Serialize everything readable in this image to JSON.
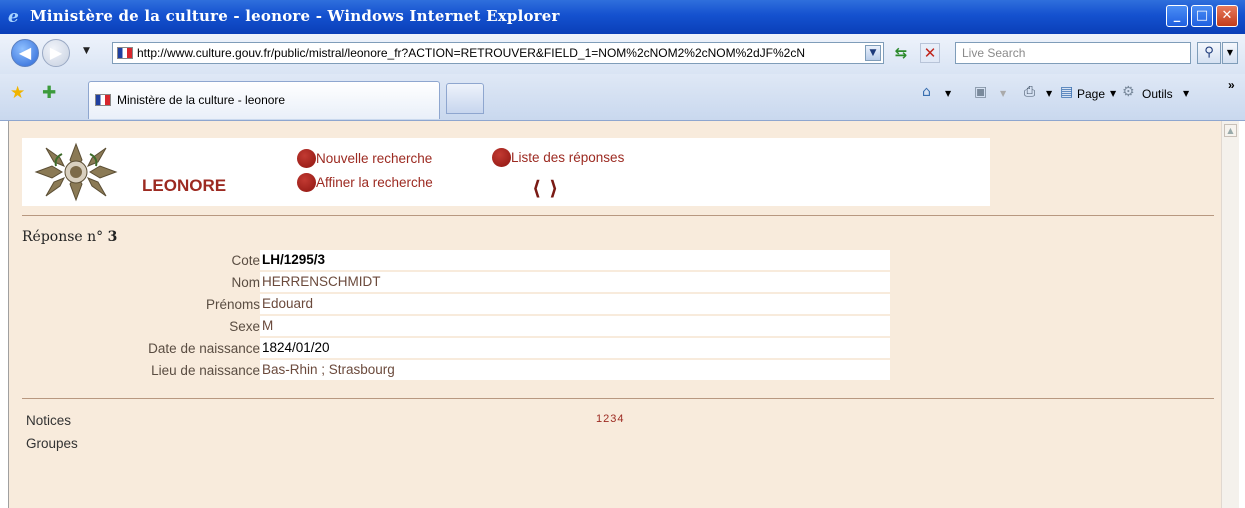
{
  "window": {
    "title": "Ministère de la culture - leonore - Windows Internet Explorer",
    "buttons": {
      "minimize": "_",
      "maximize": "□",
      "close": "✕"
    }
  },
  "addressbar": {
    "url": "http://www.culture.gouv.fr/public/mistral/leonore_fr?ACTION=RETROUVER&FIELD_1=NOM%2cNOM2%2cNOM%2dJF%2cN",
    "search_placeholder": "Live Search"
  },
  "toolbar": {
    "tab_title": "Ministère de la culture - leonore",
    "page_menu": "Page",
    "tools_menu": "Outils",
    "chevron": "»"
  },
  "page": {
    "site_title": "LEONORE",
    "links": {
      "new_search": "Nouvelle recherche",
      "refine_search": "Affiner la recherche",
      "result_list": "Liste des réponses"
    },
    "response_label": "Réponse n°",
    "response_number": "3",
    "fields": [
      {
        "label": "Cote",
        "value": "LH/1295/3"
      },
      {
        "label": "Nom",
        "value": "HERRENSCHMIDT"
      },
      {
        "label": "Prénoms",
        "value": "Edouard"
      },
      {
        "label": "Sexe",
        "value": "M"
      },
      {
        "label": "Date de naissance",
        "value": "1824/01/20"
      },
      {
        "label": "Lieu de naissance",
        "value": "Bas-Rhin ; Strasbourg"
      }
    ],
    "footer": {
      "notices": "Notices",
      "groupes": "Groupes",
      "pages": [
        "1",
        "2",
        "3",
        "4"
      ]
    }
  },
  "colors": {
    "accent": "#9c2a21",
    "page_bg": "#f8ebdc",
    "titlebar": "#1451cf"
  }
}
